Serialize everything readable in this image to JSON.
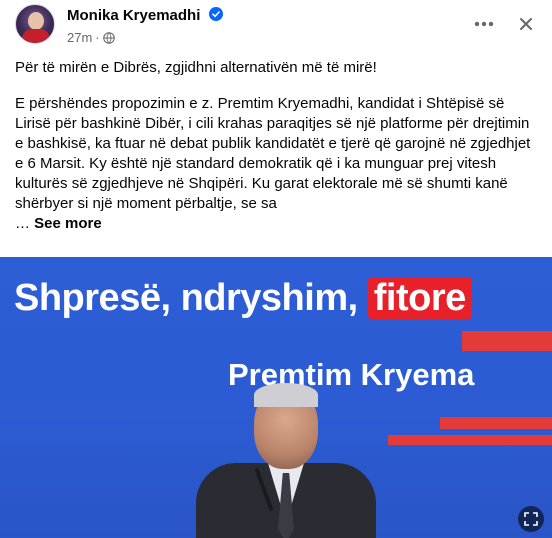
{
  "post": {
    "author": "Monika Kryemadhi",
    "time": "27m",
    "verified": true,
    "paragraph1": "Për të mirën e Dibrës, zgjidhni alternativën më të mirë!",
    "paragraph2": "E përshëndes propozimin e z. Premtim Kryemadhi, kandidat i Shtëpisë së Lirisë për bashkinë Dibër, i cili krahas paraqitjes së një platforme për drejtimin e bashkisë, ka ftuar në debat publik kandidatët e tjerë që garojnë në zgjedhjet e 6 Marsit. Ky është një standard demokratik që i ka munguar prej vitesh kulturës së zgjedhjeve në Shqipëri. Ku garat elektorale më së shumti kanë shërbyer si një moment përbaltje, se sa",
    "ellipsis": "…",
    "see_more": "See more"
  },
  "photo": {
    "slogan_part1": "Shpresë, ndryshim, ",
    "slogan_highlight": "fitore",
    "candidate_name": "Premtim Kryema"
  },
  "icons": {
    "verified": "verified-badge-icon",
    "globe": "globe-icon",
    "menu": "more-options-icon",
    "close": "close-icon",
    "fullscreen": "fullscreen-icon"
  },
  "colors": {
    "verified_blue": "#0866ff",
    "secondary_text": "#65676b",
    "slogan_red": "#e8202a",
    "backdrop_blue": "#2c5bd3"
  }
}
